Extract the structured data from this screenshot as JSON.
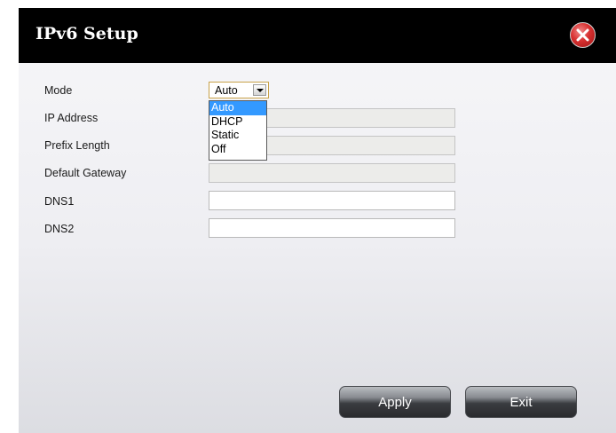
{
  "dialog": {
    "title": "IPv6 Setup"
  },
  "form": {
    "mode": {
      "label": "Mode",
      "value": "Auto",
      "options": [
        "Auto",
        "DHCP",
        "Static",
        "Off"
      ],
      "selected_index": 0
    },
    "ip_address": {
      "label": "IP Address",
      "value": ""
    },
    "prefix_length": {
      "label": "Prefix Length",
      "value": ""
    },
    "default_gateway": {
      "label": "Default Gateway",
      "value": ""
    },
    "dns1": {
      "label": "DNS1",
      "value": ""
    },
    "dns2": {
      "label": "DNS2",
      "value": ""
    }
  },
  "buttons": {
    "apply": "Apply",
    "exit": "Exit"
  },
  "icons": {
    "close": "close-icon",
    "dropdown_arrow": "chevron-down-icon"
  },
  "colors": {
    "titlebar": "#000000",
    "selection": "#3399ff",
    "close_button": "#d73030"
  }
}
